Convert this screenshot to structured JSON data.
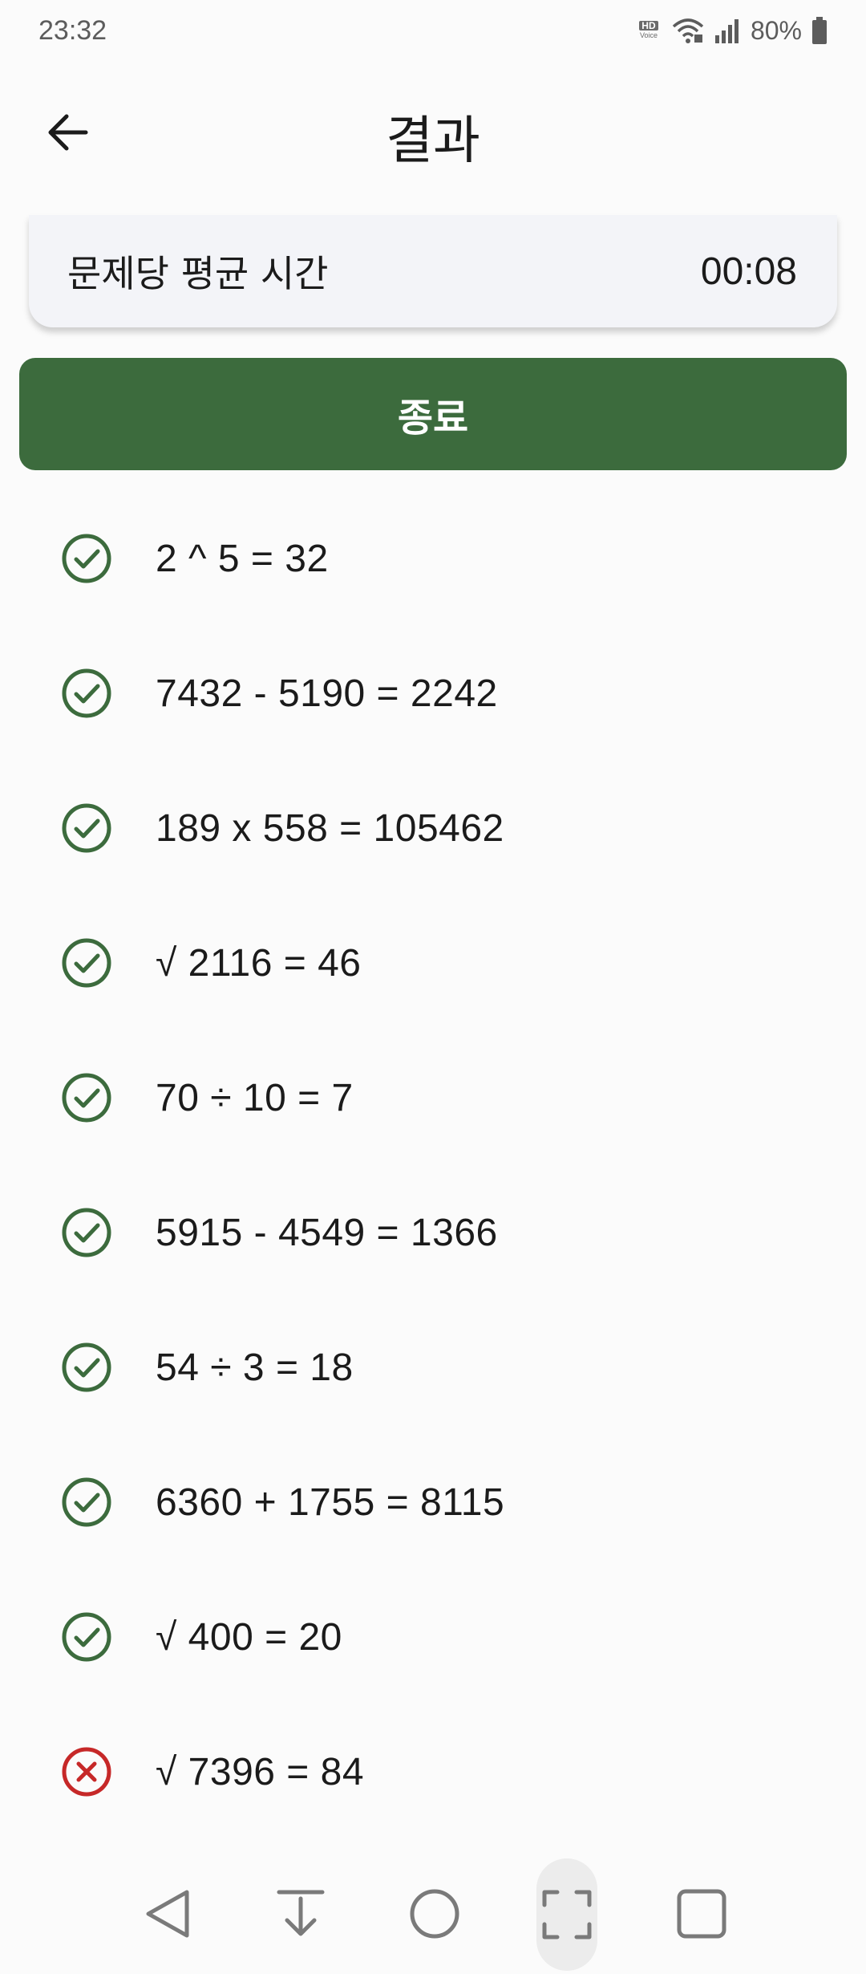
{
  "status_bar": {
    "time": "23:32",
    "battery": "80%"
  },
  "app_bar": {
    "title": "결과",
    "back_icon": "arrow-left-icon"
  },
  "summary": {
    "label": "문제당 평균 시간",
    "value": "00:08"
  },
  "exit_button": {
    "label": "종료",
    "color": "#3c6b3d"
  },
  "colors": {
    "correct": "#3c6b3d",
    "wrong": "#c62828"
  },
  "results": [
    {
      "text": "2 ^ 5 = 32",
      "status": "correct"
    },
    {
      "text": "7432 - 5190 = 2242",
      "status": "correct"
    },
    {
      "text": "189 x 558 = 105462",
      "status": "correct"
    },
    {
      "text": "√ 2116 = 46",
      "status": "correct"
    },
    {
      "text": "70 ÷ 10 = 7",
      "status": "correct"
    },
    {
      "text": "5915 - 4549 = 1366",
      "status": "correct"
    },
    {
      "text": "54 ÷ 3 = 18",
      "status": "correct"
    },
    {
      "text": "6360 + 1755 = 8115",
      "status": "correct"
    },
    {
      "text": "√ 400 = 20",
      "status": "correct"
    },
    {
      "text": "√ 7396 = 84",
      "status": "wrong"
    }
  ],
  "nav": {
    "back_icon": "triangle-back-icon",
    "download_icon": "download-arrow-icon",
    "home_icon": "circle-home-icon",
    "capture_icon": "screenshot-frame-icon",
    "recents_icon": "square-recents-icon"
  }
}
